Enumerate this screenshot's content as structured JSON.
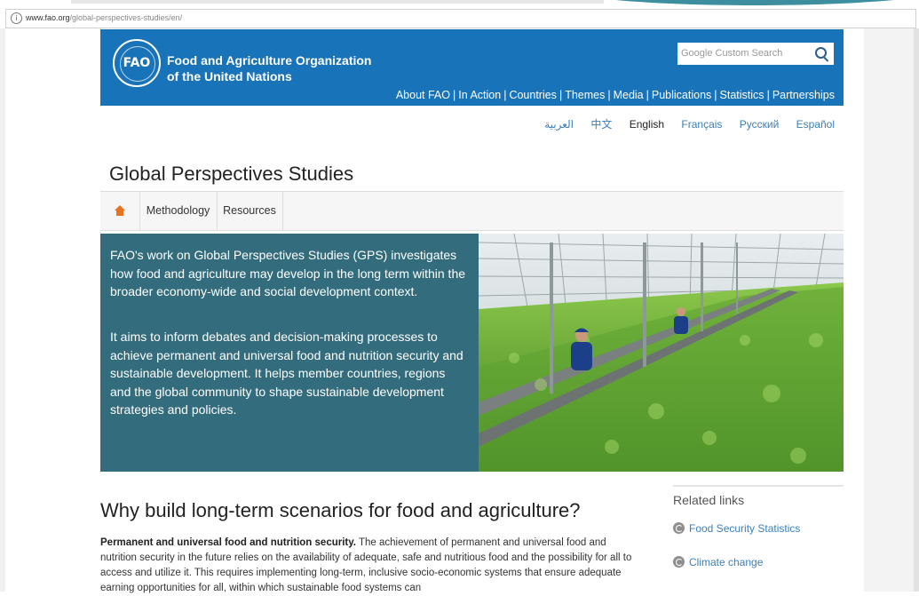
{
  "browser": {
    "url_host": "www.fao.org",
    "url_path": "/global-perspectives-studies/en/"
  },
  "header": {
    "org_line1": "Food and Agriculture Organization",
    "org_line2": "of the United Nations",
    "logo_text": "FAO",
    "search_placeholder": "Google Custom Search",
    "nav": [
      "About FAO",
      "In Action",
      "Countries",
      "Themes",
      "Media",
      "Publications",
      "Statistics",
      "Partnerships"
    ]
  },
  "languages": [
    "العربية",
    "中文",
    "English",
    "Français",
    "Русский",
    "Español"
  ],
  "active_language": "English",
  "page": {
    "title": "Global Perspectives Studies",
    "subnav": [
      "Methodology",
      "Resources"
    ]
  },
  "hero": {
    "p1": "FAO's work on Global Perspectives Studies (GPS) investigates how food and agriculture may develop in the long term within the broader economy-wide and social development context.",
    "p2": "It aims to inform debates and decision-making processes to achieve permanent and universal food and nutrition security and sustainable development. It helps member countries, regions and the global community to shape sustainable development strategies and policies."
  },
  "main": {
    "heading": "Why build long-term scenarios for food and agriculture?",
    "para_bold": "Permanent and universal food and nutrition security.",
    "para_rest": " The achievement of permanent and universal food and nutrition security in the future relies on the availability of adequate, safe and nutritious food and the possibility for all to access and utilize it. This requires implementing long-term, inclusive socio-economic systems that ensure adequate earning opportunities for all, within which sustainable food systems can"
  },
  "related": {
    "heading": "Related links",
    "links": [
      "Food Security Statistics",
      "Climate change"
    ]
  },
  "colors": {
    "header_blue": "#1873b8",
    "hero_teal": "#336c7c",
    "link_blue": "#3c7fb6",
    "home_orange": "#e8731e"
  }
}
